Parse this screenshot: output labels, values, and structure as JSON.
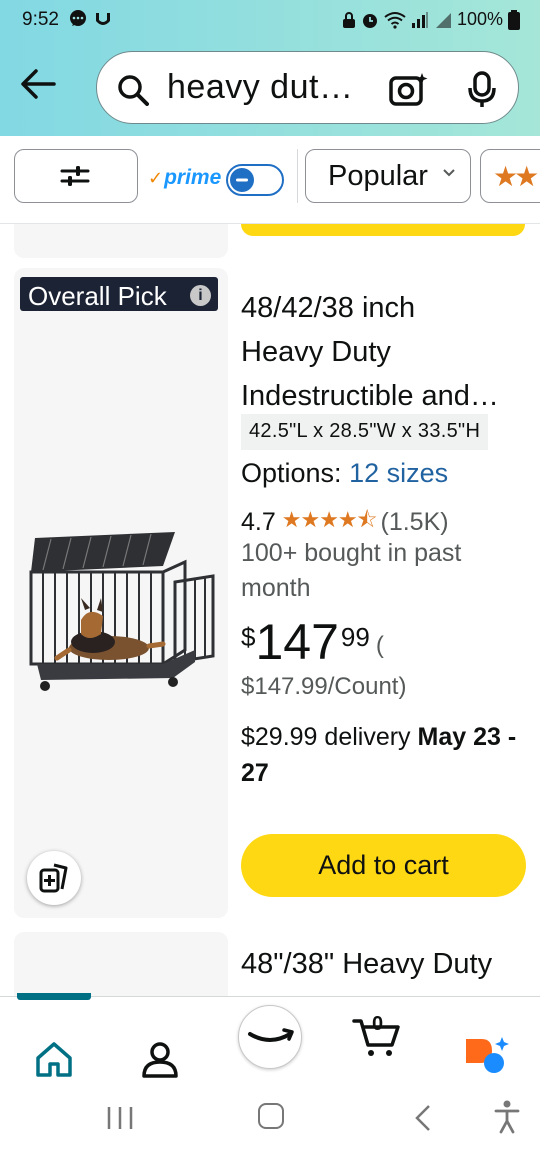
{
  "status_bar": {
    "time": "9:52",
    "battery": "100%"
  },
  "search": {
    "query": "heavy dut…"
  },
  "filters": {
    "prime_label": "prime",
    "sort_label": "Popular"
  },
  "product": {
    "badge": "Overall Pick",
    "title_line1": "48/42/38 inch",
    "title_line2": "Heavy Duty",
    "title_line3": "Indestructible and…",
    "dimensions": "42.5\"L x 28.5\"W x 33.5\"H",
    "options_label": "Options:",
    "options_value": "12 sizes",
    "rating": "4.7",
    "stars": "★★★★⯪",
    "review_count": "(1.5K)",
    "bought": "100+ bought in past month",
    "price_symbol": "$",
    "price_whole": "147",
    "price_cents": "99",
    "price_paren": "(",
    "unit_price": "$147.99/Count)",
    "delivery_prefix": "$29.99 delivery",
    "delivery_dates": "May 23 - 27",
    "add_to_cart": "Add to cart"
  },
  "next_product": {
    "title": "48\"/38\" Heavy Duty"
  },
  "bottom_nav": {
    "cart_count": "0"
  },
  "colors": {
    "header_gradient_start": "#82d8e3",
    "header_gradient_end": "#a5e6d8",
    "accent_teal": "#007185",
    "link_blue": "#2162a1",
    "star_orange": "#de7921",
    "cart_yellow": "#ffd814",
    "badge_navy": "#1b2334"
  }
}
